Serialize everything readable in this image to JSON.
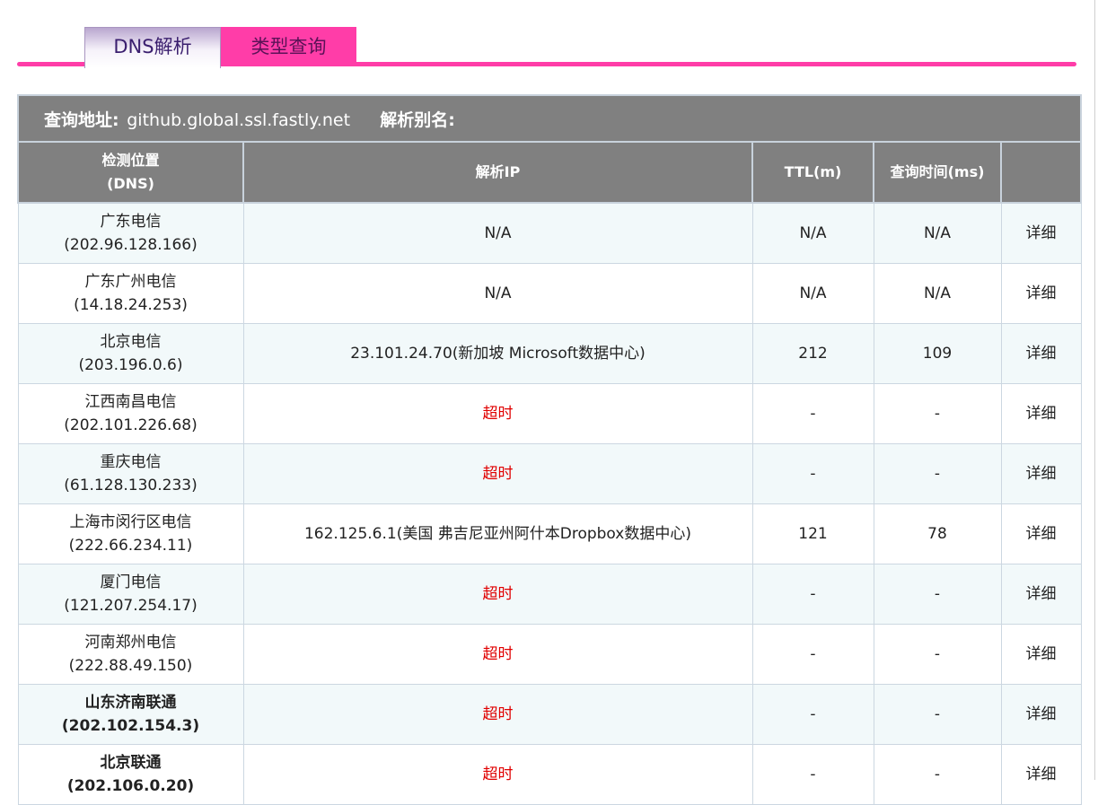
{
  "tabs": [
    {
      "label": "DNS解析",
      "active": true
    },
    {
      "label": "类型查询",
      "active": false
    }
  ],
  "query": {
    "address_label": "查询地址:",
    "address_value": "github.global.ssl.fastly.net",
    "alias_label": "解析别名:",
    "alias_value": ""
  },
  "columns": {
    "location_line1": "检测位置",
    "location_line2": "(DNS)",
    "ip": "解析IP",
    "ttl": "TTL(m)",
    "time": "查询时间(ms)",
    "detail": ""
  },
  "rows": [
    {
      "name": "广东电信",
      "dns": "(202.96.128.166)",
      "ip": "N/A",
      "ttl": "N/A",
      "time": "N/A",
      "detail": "详细",
      "timeout": false,
      "bold": false
    },
    {
      "name": "广东广州电信",
      "dns": "(14.18.24.253)",
      "ip": "N/A",
      "ttl": "N/A",
      "time": "N/A",
      "detail": "详细",
      "timeout": false,
      "bold": false
    },
    {
      "name": "北京电信",
      "dns": "(203.196.0.6)",
      "ip": "23.101.24.70(新加坡 Microsoft数据中心)",
      "ttl": "212",
      "time": "109",
      "detail": "详细",
      "timeout": false,
      "bold": false
    },
    {
      "name": "江西南昌电信",
      "dns": "(202.101.226.68)",
      "ip": "超时",
      "ttl": "-",
      "time": "-",
      "detail": "详细",
      "timeout": true,
      "bold": false
    },
    {
      "name": "重庆电信",
      "dns": "(61.128.130.233)",
      "ip": "超时",
      "ttl": "-",
      "time": "-",
      "detail": "详细",
      "timeout": true,
      "bold": false
    },
    {
      "name": "上海市闵行区电信",
      "dns": "(222.66.234.11)",
      "ip": "162.125.6.1(美国 弗吉尼亚州阿什本Dropbox数据中心)",
      "ttl": "121",
      "time": "78",
      "detail": "详细",
      "timeout": false,
      "bold": false
    },
    {
      "name": "厦门电信",
      "dns": "(121.207.254.17)",
      "ip": "超时",
      "ttl": "-",
      "time": "-",
      "detail": "详细",
      "timeout": true,
      "bold": false
    },
    {
      "name": "河南郑州电信",
      "dns": "(222.88.49.150)",
      "ip": "超时",
      "ttl": "-",
      "time": "-",
      "detail": "详细",
      "timeout": true,
      "bold": false
    },
    {
      "name": "山东济南联通",
      "dns": "(202.102.154.3)",
      "ip": "超时",
      "ttl": "-",
      "time": "-",
      "detail": "详细",
      "timeout": true,
      "bold": true
    },
    {
      "name": "北京联通",
      "dns": "(202.106.0.20)",
      "ip": "超时",
      "ttl": "-",
      "time": "-",
      "detail": "详细",
      "timeout": true,
      "bold": true
    }
  ],
  "colors": {
    "accent": "#ff3da8",
    "header_bg": "#808080",
    "timeout": "#e00000",
    "row_alt": "#f2f9fa"
  }
}
